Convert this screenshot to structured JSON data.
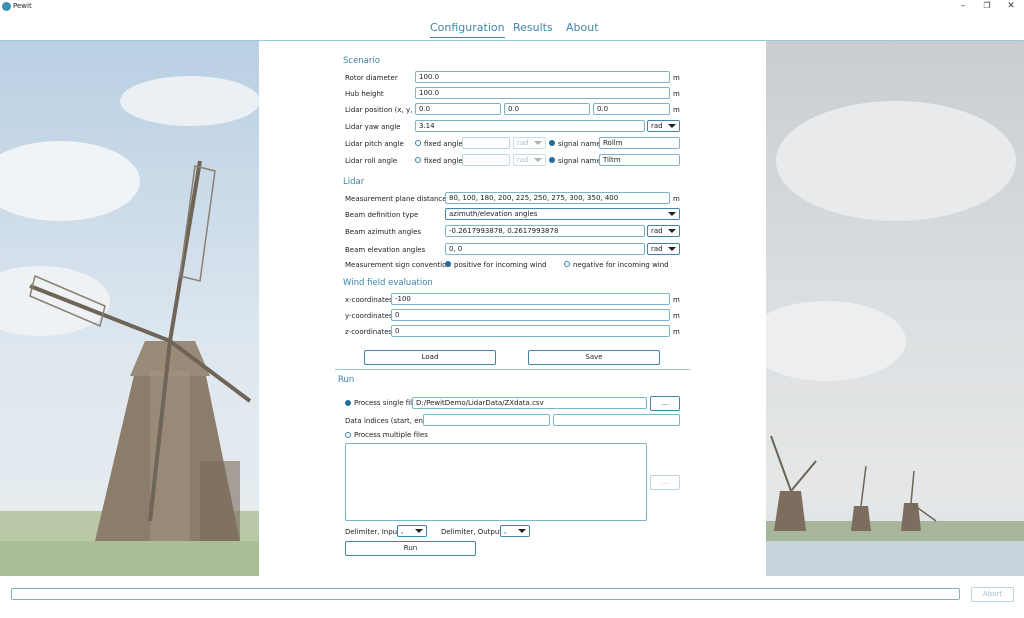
{
  "window": {
    "title": "Pewit",
    "minimize": "–",
    "maximize": "❐",
    "close": "✕"
  },
  "tabs": [
    {
      "label": "Configuration"
    },
    {
      "label": "Results"
    },
    {
      "label": "About"
    }
  ],
  "scenario": {
    "title": "Scenario",
    "rotor_diameter": {
      "label": "Rotor diameter",
      "value": "100.0",
      "unit": "m"
    },
    "hub_height": {
      "label": "Hub height",
      "value": "100.0",
      "unit": "m"
    },
    "lidar_position": {
      "label": "Lidar position (x, y, z)",
      "x": "0.0",
      "y": "0.0",
      "z": "0.0",
      "unit": "m"
    },
    "lidar_yaw": {
      "label": "Lidar yaw angle",
      "value": "3.14",
      "unit": "rad"
    },
    "lidar_pitch": {
      "label": "Lidar pitch angle",
      "fixed_label": "fixed angle",
      "unit": "rad",
      "signal_label": "signal name",
      "signal_value": "Rollm"
    },
    "lidar_roll": {
      "label": "Lidar roll angle",
      "fixed_label": "fixed angle",
      "unit": "rad",
      "signal_label": "signal name",
      "signal_value": "Tiltm"
    }
  },
  "lidar": {
    "title": "Lidar",
    "plane_distances": {
      "label": "Measurement plane distances",
      "value": "80, 100, 180, 200, 225, 250, 275, 300, 350, 400",
      "unit": "m"
    },
    "beam_def": {
      "label": "Beam definition type",
      "value": "azimuth/elevation angles"
    },
    "azimuth": {
      "label": "Beam azimuth angles",
      "value": "-0.2617993878, 0.2617993878",
      "unit": "rad"
    },
    "elevation": {
      "label": "Beam elevation angles",
      "value": "0, 0",
      "unit": "rad"
    },
    "sign": {
      "label": "Measurement sign convention",
      "positive": "positive for incoming wind",
      "negative": "negative for incoming wind"
    }
  },
  "wind": {
    "title": "Wind field evaluation",
    "x": {
      "label": "x-coordinates",
      "value": "-100",
      "unit": "m"
    },
    "y": {
      "label": "y-coordinates",
      "value": "0",
      "unit": "m"
    },
    "z": {
      "label": "z-coordinates",
      "value": "0",
      "unit": "m"
    }
  },
  "buttons": {
    "load": "Load",
    "save": "Save",
    "browse_single": "...",
    "browse_multi": "...",
    "run": "Run",
    "abort": "Abort"
  },
  "run": {
    "title": "Run",
    "single_label": "Process single file",
    "single_path": "D:/PewitDemo/LidarData/ZXdata.csv",
    "indices_label": "Data indices (start, end)",
    "index_start": "",
    "index_end": "",
    "multi_label": "Process multiple files",
    "delim_in_label": "Delimiter, Input",
    "delim_in_value": ",",
    "delim_out_label": "Delimiter, Output",
    "delim_out_value": ","
  },
  "progress": {
    "fraction": 0
  },
  "colors": {
    "accent": "#3f86a8",
    "radio_on": "#1f6e9b",
    "border": "#7fb3c7"
  },
  "icons": {
    "app": "pewit-logo-icon",
    "dropdown": "chevron-down-icon"
  }
}
